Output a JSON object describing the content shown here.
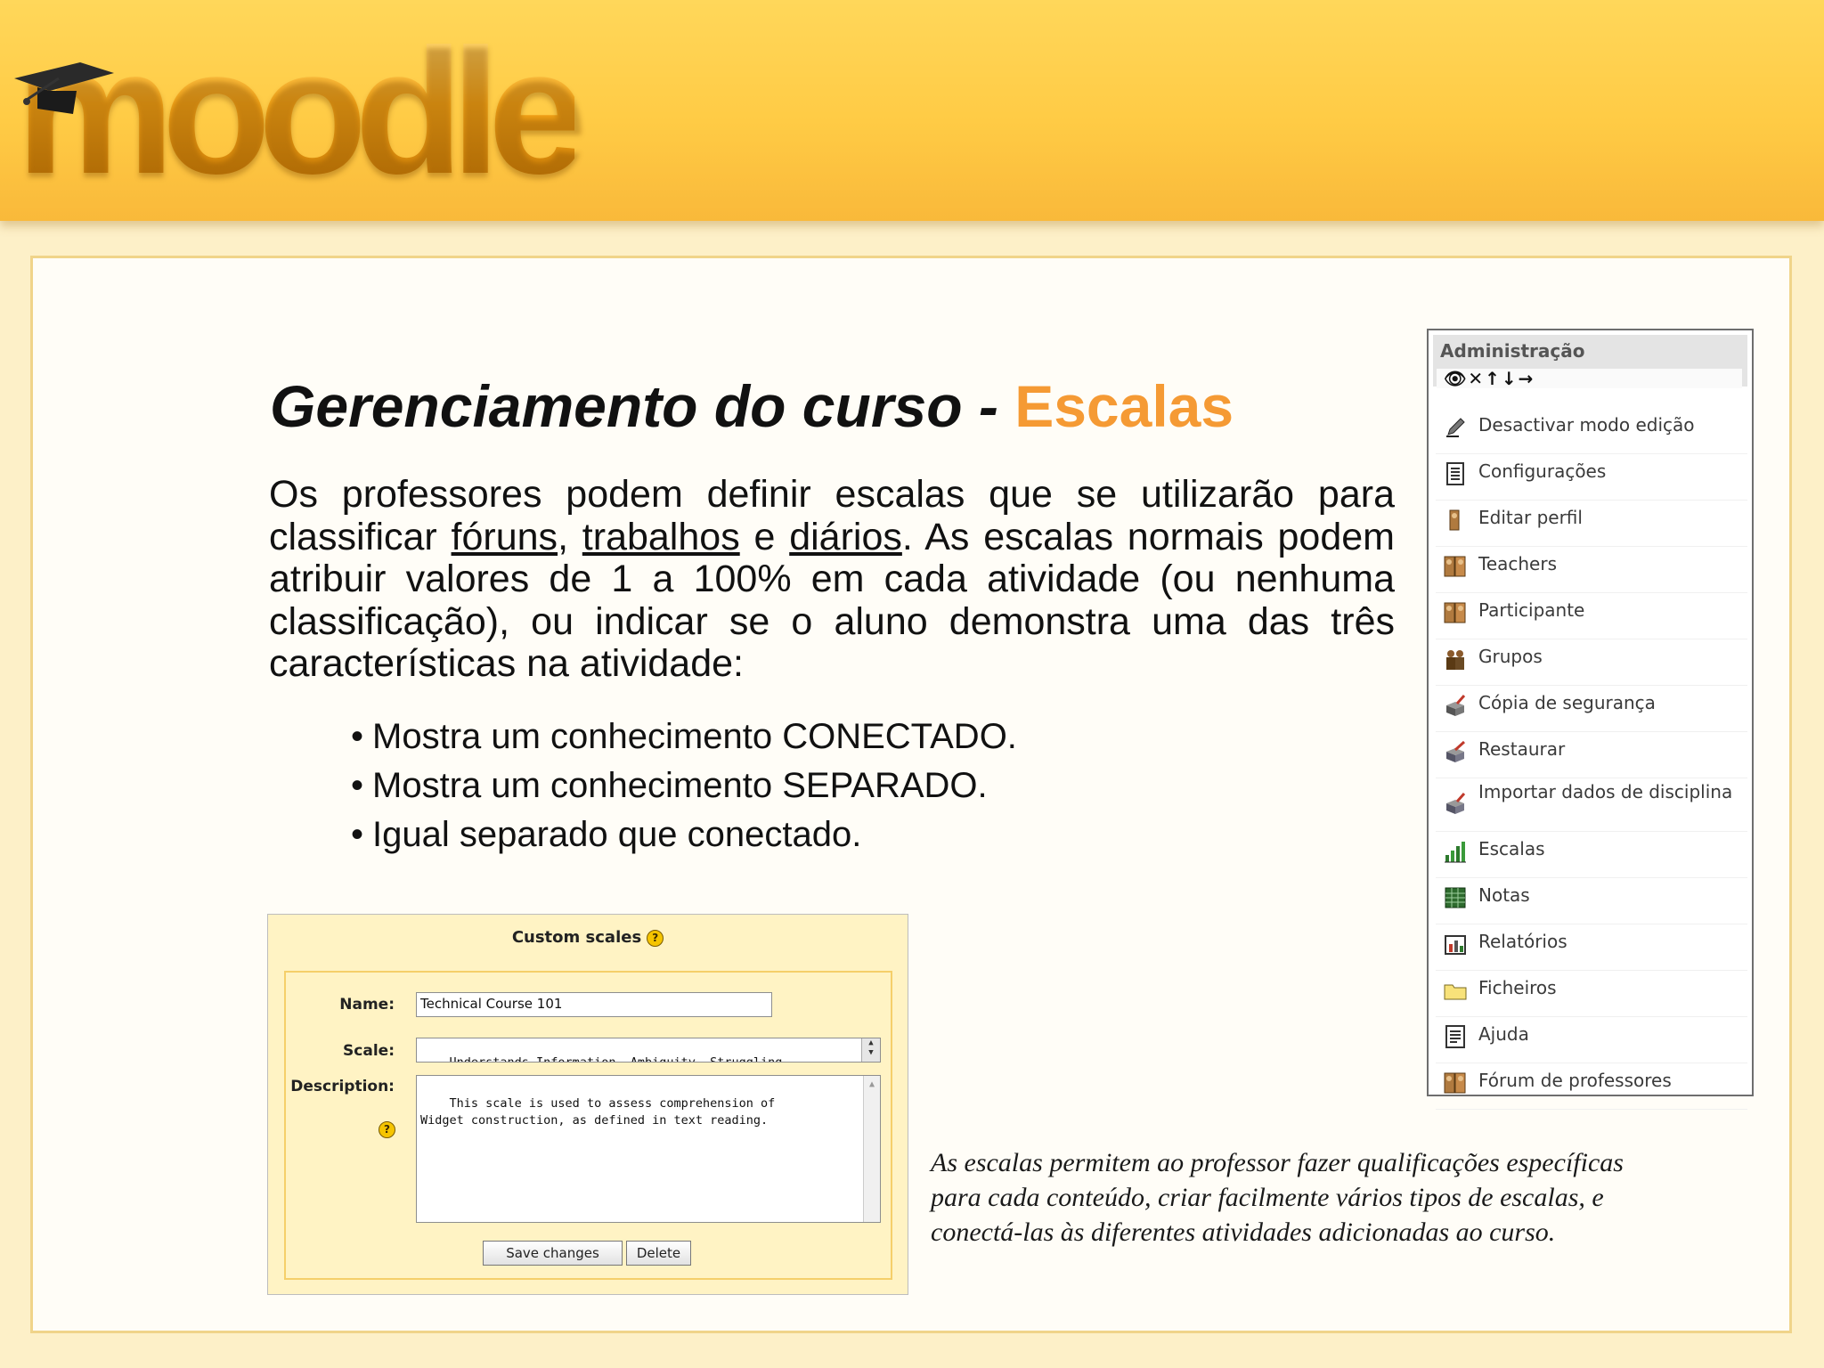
{
  "header": {
    "logo_text": "moodle"
  },
  "slide": {
    "title_main": "Gerenciamento do curso - ",
    "title_highlight": "Escalas",
    "paragraph": {
      "t1": "Os professores podem definir escalas que se utilizarão para classificar ",
      "link1": "fóruns",
      "t2": ", ",
      "link2": "trabalhos",
      "t3": " e ",
      "link3": "diários",
      "t4": ".  As escalas normais podem atribuir valores de 1 a 100% em cada atividade (ou nenhuma classificação), ou indicar se o aluno demonstra uma das três características na atividade:"
    },
    "bullets": [
      "Mostra um conhecimento CONECTADO.",
      "Mostra um conhecimento SEPARADO.",
      "Igual separado que conectado."
    ],
    "caption": "As escalas permitem ao professor fazer qualificações específicas para cada conteúdo, criar facilmente vários tipos de escalas, e conectá-las às diferentes atividades adicionadas ao curso."
  },
  "form": {
    "title": "Custom scales",
    "help_symbol": "?",
    "name_label": "Name:",
    "name_value": "Technical Course 101",
    "scale_label": "Scale:",
    "scale_value": "Understands Information, Ambiguity, Struggling,",
    "description_label": "Description:",
    "description_value": "This scale is used to assess comprehension of\nWidget construction, as defined in text reading.",
    "save_label": "Save changes",
    "delete_label": "Delete"
  },
  "admin": {
    "title": "Administração",
    "header_icons": "👁✕↑↓→",
    "items": [
      {
        "label": "Desactivar modo edição",
        "icon": "edit-icon"
      },
      {
        "label": "Configurações",
        "icon": "settings-document-icon"
      },
      {
        "label": "Editar perfil",
        "icon": "profile-icon"
      },
      {
        "label": "Teachers",
        "icon": "teachers-icon"
      },
      {
        "label": "Participante",
        "icon": "participants-icon"
      },
      {
        "label": "Grupos",
        "icon": "groups-icon"
      },
      {
        "label": "Cópia de segurança",
        "icon": "backup-icon"
      },
      {
        "label": "Restaurar",
        "icon": "restore-icon"
      },
      {
        "label": "Importar dados de disciplina",
        "icon": "import-icon"
      },
      {
        "label": "Escalas",
        "icon": "scales-icon"
      },
      {
        "label": "Notas",
        "icon": "grades-icon"
      },
      {
        "label": "Relatórios",
        "icon": "reports-icon"
      },
      {
        "label": "Ficheiros",
        "icon": "folder-icon"
      },
      {
        "label": "Ajuda",
        "icon": "help-document-icon"
      },
      {
        "label": "Fórum de professores",
        "icon": "teacher-forum-icon"
      }
    ]
  }
}
